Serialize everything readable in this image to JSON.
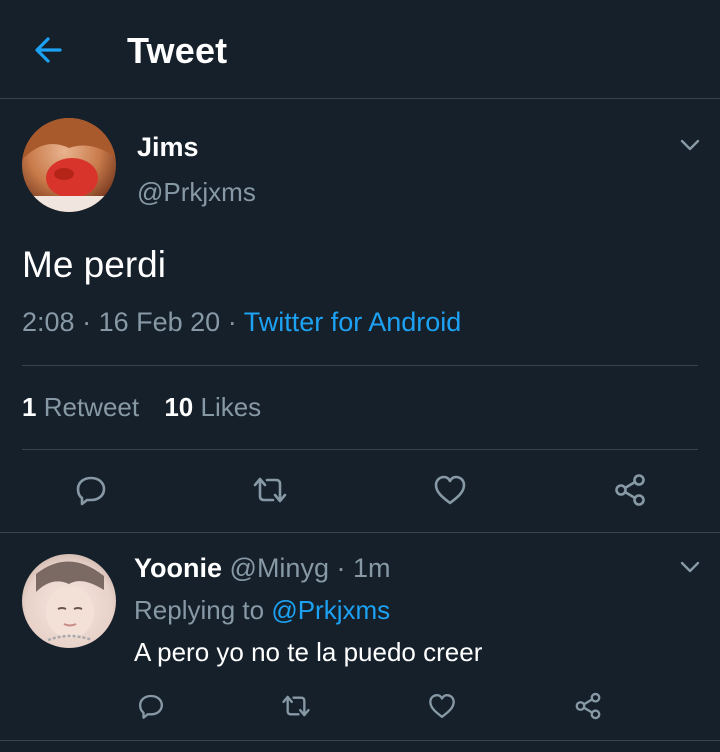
{
  "header": {
    "title": "Tweet",
    "back_icon": "arrow-left-icon"
  },
  "colors": {
    "background": "#15202b",
    "accent": "#1da1f2",
    "secondary_text": "#8899a6",
    "divider": "#38444d"
  },
  "tweet": {
    "author_name": "Jims",
    "author_handle": "@Prkjxms",
    "text": "Me perdi",
    "time": "2:08",
    "date": "16 Feb 20",
    "source": "Twitter for Android",
    "retweet_count": "1",
    "retweet_label": "Retweet",
    "like_count": "10",
    "like_label": "Likes",
    "actions": [
      "reply-icon",
      "retweet-icon",
      "like-icon",
      "share-icon"
    ]
  },
  "reply": {
    "author_name": "Yoonie",
    "author_handle": "@Minyg",
    "time": "1m",
    "replying_to_label": "Replying to",
    "replying_to_handle": "@Prkjxms",
    "text": "A pero yo no te la puedo creer",
    "actions": [
      "reply-icon",
      "retweet-icon",
      "like-icon",
      "share-icon"
    ]
  }
}
